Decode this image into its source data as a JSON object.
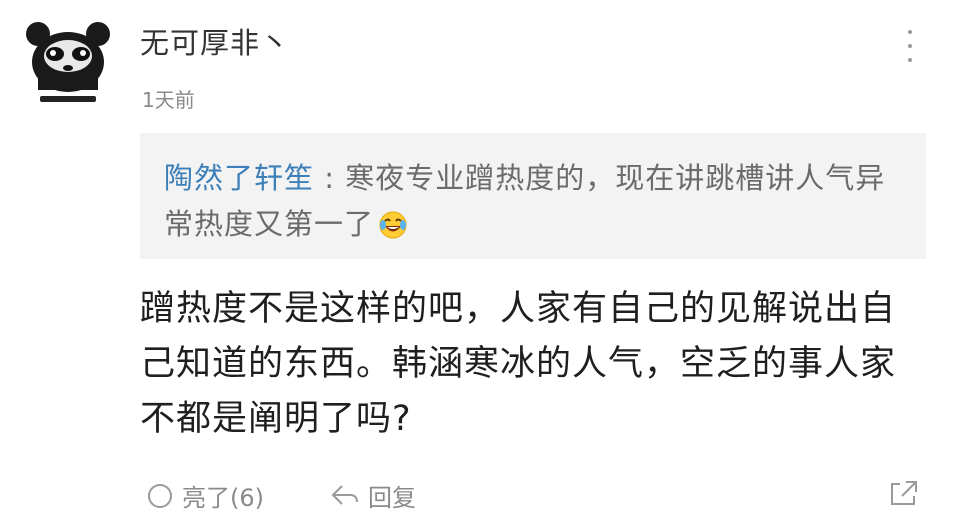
{
  "comment": {
    "username": "无可厚非丶",
    "time": "1天前",
    "quote": {
      "user": "陶然了轩笙",
      "separator": " : ",
      "text": "寒夜专业蹭热度的，现在讲跳槽讲人气异常热度又第一了"
    },
    "body": "蹭热度不是这样的吧，人家有自己的见解说出自己知道的东西。韩涵寒冰的人气，空乏的事人家不都是阐明了吗?",
    "actions": {
      "like_label": "亮了(6)",
      "reply_label": "回复"
    }
  },
  "icons": {
    "avatar": "panda-avatar",
    "more": "more-vertical-icon",
    "emoji": "laughing-tears-emoji",
    "like": "like-icon",
    "reply": "reply-icon",
    "share": "share-icon"
  },
  "colors": {
    "link": "#3d7fb8",
    "quote_bg": "#f3f3f3",
    "meta": "#8a8a8a",
    "body_text": "#1f1f1f"
  }
}
